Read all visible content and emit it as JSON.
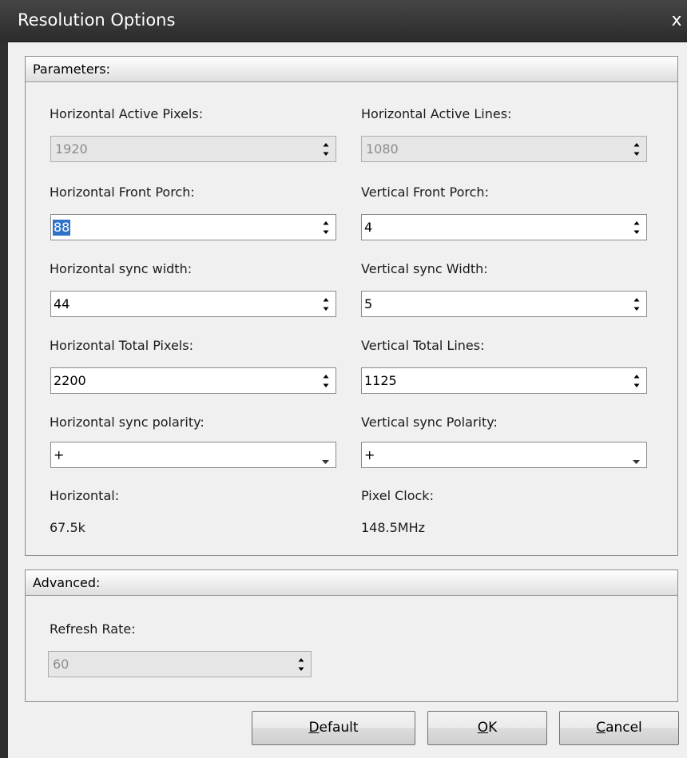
{
  "window": {
    "title": "Resolution Options",
    "close_label": "x"
  },
  "parameters": {
    "header": "Parameters:",
    "h_active_pixels": {
      "label": "Horizontal Active Pixels:",
      "value": "1920",
      "enabled": false
    },
    "h_active_lines": {
      "label": "Horizontal Active Lines:",
      "value": "1080",
      "enabled": false
    },
    "h_front_porch": {
      "label": "Horizontal Front Porch:",
      "value": "88",
      "selected": true
    },
    "v_front_porch": {
      "label": "Vertical Front Porch:",
      "value": "4"
    },
    "h_sync_width": {
      "label": "Horizontal sync width:",
      "value": "44"
    },
    "v_sync_width": {
      "label": "Vertical sync Width:",
      "value": "5"
    },
    "h_total_pixels": {
      "label": "Horizontal Total Pixels:",
      "value": "2200"
    },
    "v_total_lines": {
      "label": "Vertical Total Lines:",
      "value": "1125"
    },
    "h_sync_polarity": {
      "label": "Horizontal sync polarity:",
      "value": "+"
    },
    "v_sync_polarity": {
      "label": "Vertical sync Polarity:",
      "value": "+"
    },
    "horizontal": {
      "label": "Horizontal:",
      "value": "67.5k"
    },
    "pixel_clock": {
      "label": "Pixel Clock:",
      "value": "148.5MHz"
    }
  },
  "advanced": {
    "header": "Advanced:",
    "refresh_rate": {
      "label": "Refresh Rate:",
      "value": "60",
      "enabled": false
    }
  },
  "buttons": {
    "default": {
      "mnemonic": "D",
      "rest": "efault"
    },
    "ok": {
      "mnemonic": "O",
      "rest": "K"
    },
    "cancel": {
      "mnemonic": "C",
      "rest": "ancel"
    }
  },
  "colors": {
    "titlebar": "#2b2b2b",
    "selection": "#3072c8",
    "disabled_field": "#e6e6e6"
  },
  "icons": [
    "close-icon",
    "spin-arrows-icon",
    "dropdown-arrow-icon"
  ]
}
